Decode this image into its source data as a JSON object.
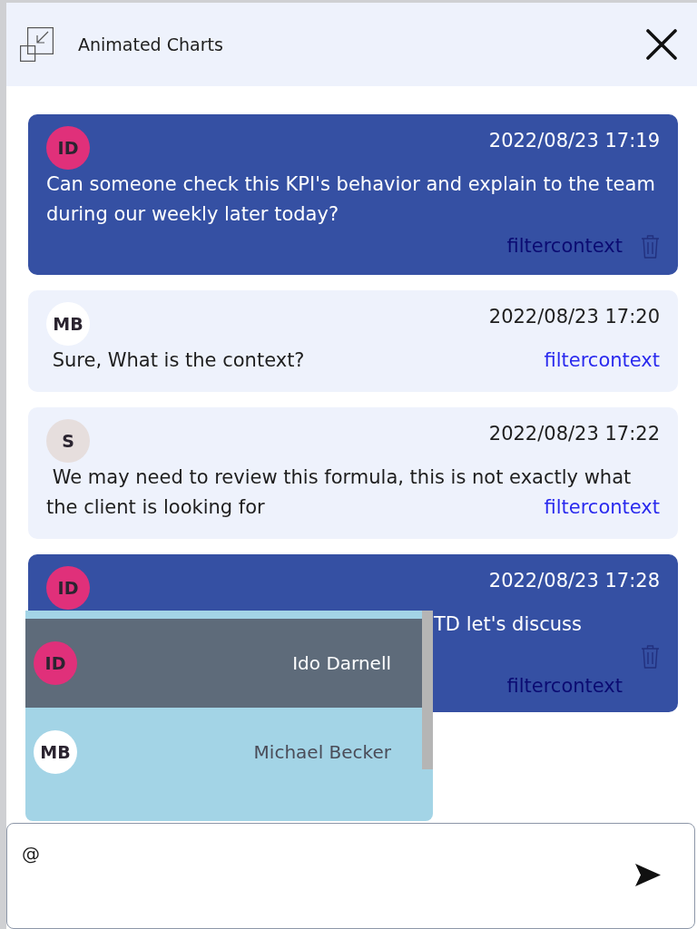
{
  "window": {
    "title": "Animated Charts"
  },
  "messages": [
    {
      "own": true,
      "kind": "row",
      "covered": false,
      "deletable": true,
      "avatar": {
        "initials": "ID",
        "color": "#e0307a"
      },
      "time": "2022/08/23 17:19",
      "text": "Can someone check this KPI's behavior and explain to the team during our weekly later today?",
      "link": "filtercontext"
    },
    {
      "own": false,
      "kind": "inline",
      "covered": false,
      "deletable": false,
      "avatar": {
        "initials": "MB",
        "color": "#ffffff"
      },
      "time": "2022/08/23 17:20",
      "text": " Sure, What is the context?",
      "link": "filtercontext"
    },
    {
      "own": false,
      "kind": "inline",
      "covered": false,
      "deletable": false,
      "avatar": {
        "initials": "S",
        "color": "#e6dedd"
      },
      "time": "2022/08/23 17:22",
      "text": " We may need to review this formula, this is not exactly what the client is looking for",
      "link": "filtercontext"
    },
    {
      "own": true,
      "kind": "stacked",
      "covered": true,
      "deletable": true,
      "avatar": {
        "initials": "ID",
        "color": "#e0307a"
      },
      "time": "2022/08/23 17:28",
      "text": "TD let's discuss",
      "link": "filtercontext"
    }
  ],
  "mention_suggestions": [
    {
      "initials": "ID",
      "color": "#e0307a",
      "name": "Ido Darnell",
      "selected": true
    },
    {
      "initials": "MB",
      "color": "#ffffff",
      "name": "Michael Becker",
      "selected": false
    }
  ],
  "composer": {
    "value": "@"
  }
}
